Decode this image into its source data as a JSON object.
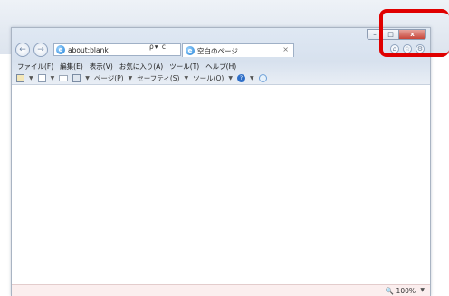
{
  "window": {
    "caption_minimize": "–",
    "caption_maximize": "□",
    "caption_close": "x"
  },
  "nav": {
    "back_glyph": "←",
    "forward_glyph": "→",
    "address_value": "about:blank",
    "address_tools": "ρ▾ c",
    "tab_title": "空白のページ",
    "tab_close": "×"
  },
  "right_icons": [
    "home-icon",
    "favorites-star-icon",
    "tools-gear-icon"
  ],
  "menu": [
    "ファイル(F)",
    "編集(E)",
    "表示(V)",
    "お気に入り(A)",
    "ツール(T)",
    "ヘルプ(H)"
  ],
  "command_bar": {
    "page_label": "ページ(P)",
    "safety_label": "セーフティ(S)",
    "tools_label": "ツール(O)"
  },
  "status": {
    "zoom": "100%"
  },
  "colors": {
    "highlight": "#e00000",
    "close_button": "#c7453a",
    "status_bar": "#fbeeee"
  }
}
